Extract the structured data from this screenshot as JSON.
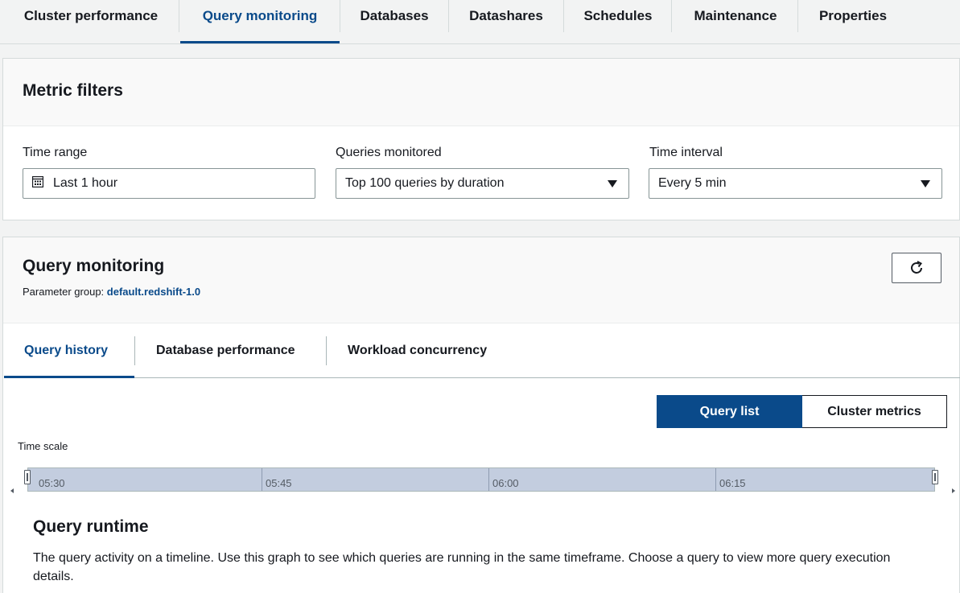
{
  "top_tabs": [
    {
      "label": "Cluster performance"
    },
    {
      "label": "Query monitoring"
    },
    {
      "label": "Databases"
    },
    {
      "label": "Datashares"
    },
    {
      "label": "Schedules"
    },
    {
      "label": "Maintenance"
    },
    {
      "label": "Properties"
    }
  ],
  "active_top_tab": "Query monitoring",
  "metric_filters": {
    "title": "Metric filters",
    "time_range": {
      "label": "Time range",
      "value": "Last 1 hour",
      "icon": "calendar-icon"
    },
    "queries_monitored": {
      "label": "Queries monitored",
      "value": "Top 100 queries by duration"
    },
    "time_interval": {
      "label": "Time interval",
      "value": "Every 5 min"
    }
  },
  "query_monitoring": {
    "title": "Query monitoring",
    "parameter_group_label": "Parameter group:",
    "parameter_group_value": "default.redshift-1.0",
    "refresh_icon": "refresh-icon",
    "sub_tabs": [
      {
        "label": "Query history"
      },
      {
        "label": "Database performance"
      },
      {
        "label": "Workload concurrency"
      }
    ],
    "active_sub_tab": "Query history",
    "view_toggle": {
      "selected": "Query list",
      "options": [
        "Query list",
        "Cluster metrics"
      ]
    },
    "time_scale": {
      "label": "Time scale",
      "ticks": [
        "05:30",
        "05:45",
        "06:00",
        "06:15"
      ]
    },
    "runtime": {
      "title": "Query runtime",
      "description": "The query activity on a timeline. Use this graph to see which queries are running in the same timeframe. Choose a query to view more query execution details."
    }
  },
  "colors": {
    "accent": "#0a4a8a",
    "scale_bar": "#c3cddf",
    "background": "#f2f3f3"
  }
}
